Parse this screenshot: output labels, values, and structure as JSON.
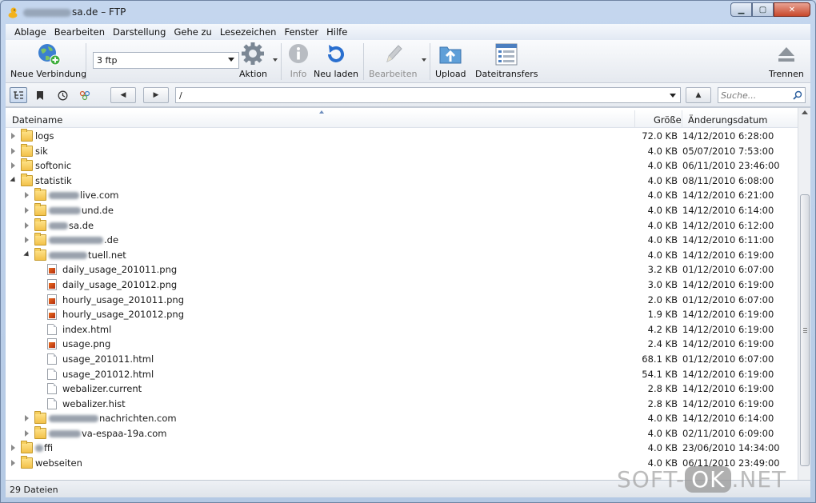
{
  "window": {
    "title_suffix": "sa.de – FTP",
    "minimize": "▁",
    "maximize": "▢",
    "close": "✕"
  },
  "menu": [
    "Ablage",
    "Bearbeiten",
    "Darstellung",
    "Gehe zu",
    "Lesezeichen",
    "Fenster",
    "Hilfe"
  ],
  "toolbar": {
    "new_connection": "Neue Verbindung",
    "server_value": "3        ftp",
    "action": "Aktion",
    "info": "Info",
    "reload": "Neu laden",
    "edit": "Bearbeiten",
    "upload": "Upload",
    "transfers": "Dateitransfers",
    "disconnect": "Trennen"
  },
  "nav": {
    "back": "◀",
    "forward": "▶",
    "path": "/",
    "up": "▲",
    "search_placeholder": "Suche..."
  },
  "columns": {
    "name": "Dateiname",
    "size": "Größe",
    "modified": "Änderungsdatum"
  },
  "files": [
    {
      "name": "logs",
      "type": "folder",
      "level": 0,
      "expanded": false,
      "size": "72.0 KB",
      "date": "14/12/2010 6:28:00"
    },
    {
      "name": "sik",
      "type": "folder",
      "level": 0,
      "expanded": false,
      "size": "4.0 KB",
      "date": "05/07/2010 7:53:00"
    },
    {
      "name": "softonic",
      "type": "folder",
      "level": 0,
      "expanded": false,
      "size": "4.0 KB",
      "date": "06/11/2010 23:46:00"
    },
    {
      "name": "statistik",
      "type": "folder",
      "level": 0,
      "expanded": true,
      "size": "4.0 KB",
      "date": "08/11/2010 6:08:00"
    },
    {
      "name": "live.com",
      "blur": 38,
      "type": "folder",
      "level": 1,
      "expanded": false,
      "size": "4.0 KB",
      "date": "14/12/2010 6:21:00"
    },
    {
      "name": "und.de",
      "blur": 40,
      "type": "folder",
      "level": 1,
      "expanded": false,
      "size": "4.0 KB",
      "date": "14/12/2010 6:14:00"
    },
    {
      "name": "sa.de",
      "blur": 24,
      "type": "folder",
      "level": 1,
      "expanded": false,
      "size": "4.0 KB",
      "date": "14/12/2010 6:12:00"
    },
    {
      "name": ".de",
      "blur": 68,
      "type": "folder",
      "level": 1,
      "expanded": false,
      "size": "4.0 KB",
      "date": "14/12/2010 6:11:00"
    },
    {
      "name": "tuell.net",
      "blur": 48,
      "type": "folder",
      "level": 1,
      "expanded": true,
      "size": "4.0 KB",
      "date": "14/12/2010 6:19:00"
    },
    {
      "name": "daily_usage_201011.png",
      "type": "image",
      "level": 2,
      "size": "3.2 KB",
      "date": "01/12/2010 6:07:00"
    },
    {
      "name": "daily_usage_201012.png",
      "type": "image",
      "level": 2,
      "size": "3.0 KB",
      "date": "14/12/2010 6:19:00"
    },
    {
      "name": "hourly_usage_201011.png",
      "type": "image",
      "level": 2,
      "size": "2.0 KB",
      "date": "01/12/2010 6:07:00"
    },
    {
      "name": "hourly_usage_201012.png",
      "type": "image",
      "level": 2,
      "size": "1.9 KB",
      "date": "14/12/2010 6:19:00"
    },
    {
      "name": "index.html",
      "type": "doc",
      "level": 2,
      "size": "4.2 KB",
      "date": "14/12/2010 6:19:00"
    },
    {
      "name": "usage.png",
      "type": "image",
      "level": 2,
      "size": "2.4 KB",
      "date": "14/12/2010 6:19:00"
    },
    {
      "name": "usage_201011.html",
      "type": "doc",
      "level": 2,
      "size": "68.1 KB",
      "date": "01/12/2010 6:07:00"
    },
    {
      "name": "usage_201012.html",
      "type": "doc",
      "level": 2,
      "size": "54.1 KB",
      "date": "14/12/2010 6:19:00"
    },
    {
      "name": "webalizer.current",
      "type": "doc",
      "level": 2,
      "size": "2.8 KB",
      "date": "14/12/2010 6:19:00"
    },
    {
      "name": "webalizer.hist",
      "type": "doc",
      "level": 2,
      "size": "2.8 KB",
      "date": "14/12/2010 6:19:00"
    },
    {
      "name": "nachrichten.com",
      "blur": 62,
      "type": "folder",
      "level": 1,
      "expanded": false,
      "size": "4.0 KB",
      "date": "14/12/2010 6:14:00"
    },
    {
      "name": "va-espaa-19a.com",
      "blur": 40,
      "type": "folder",
      "level": 1,
      "expanded": false,
      "size": "4.0 KB",
      "date": "02/11/2010 6:09:00"
    },
    {
      "name": "ffi",
      "blur": 10,
      "type": "folder",
      "level": 0,
      "expanded": false,
      "size": "4.0 KB",
      "date": "23/06/2010 14:34:00"
    },
    {
      "name": "webseiten",
      "type": "folder",
      "level": 0,
      "expanded": false,
      "size": "4.0 KB",
      "date": "06/11/2010 23:49:00"
    }
  ],
  "status": "29 Dateien",
  "watermark": {
    "left": "SOFT-",
    "ok": "OK",
    "right": ".NET"
  }
}
